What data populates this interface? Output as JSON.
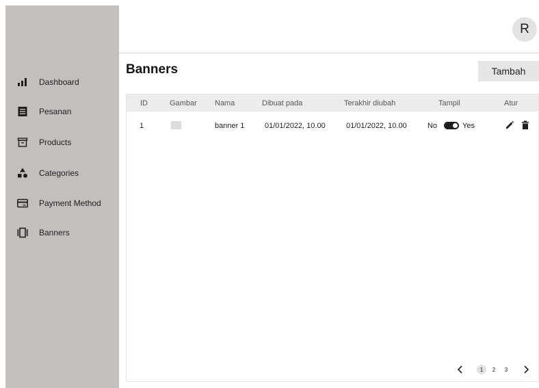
{
  "sidebar": {
    "items": [
      {
        "label": "Dashboard",
        "icon": "bar-chart-icon"
      },
      {
        "label": "Pesanan",
        "icon": "document-icon"
      },
      {
        "label": "Products",
        "icon": "archive-box-icon"
      },
      {
        "label": "Categories",
        "icon": "shapes-icon"
      },
      {
        "label": "Payment Method",
        "icon": "credit-card-icon"
      },
      {
        "label": "Banners",
        "icon": "carousel-icon"
      }
    ]
  },
  "header": {
    "avatar_initial": "R"
  },
  "page": {
    "title": "Banners",
    "add_label": "Tambah"
  },
  "table": {
    "columns": [
      "ID",
      "Gambar",
      "Nama",
      "Dibuat pada",
      "Terakhir diubah",
      "Tampil",
      "Atur"
    ],
    "rows": [
      {
        "id": "1",
        "gambar": "",
        "nama": "banner 1",
        "dibuat_pada": "01/01/2022, 10.00",
        "terakhir_diubah": "01/01/2022, 10.00",
        "tampil_off_label": "No",
        "tampil_on_label": "Yes",
        "tampil_value": true
      }
    ]
  },
  "pagination": {
    "pages": [
      "1",
      "2",
      "3"
    ],
    "current": "1"
  },
  "colors": {
    "sidebar_bg": "#c4bebd",
    "header_bg": "#e6e6e6",
    "button_bg": "#e6e6e6",
    "toggle_on": "#1e1e1e"
  }
}
